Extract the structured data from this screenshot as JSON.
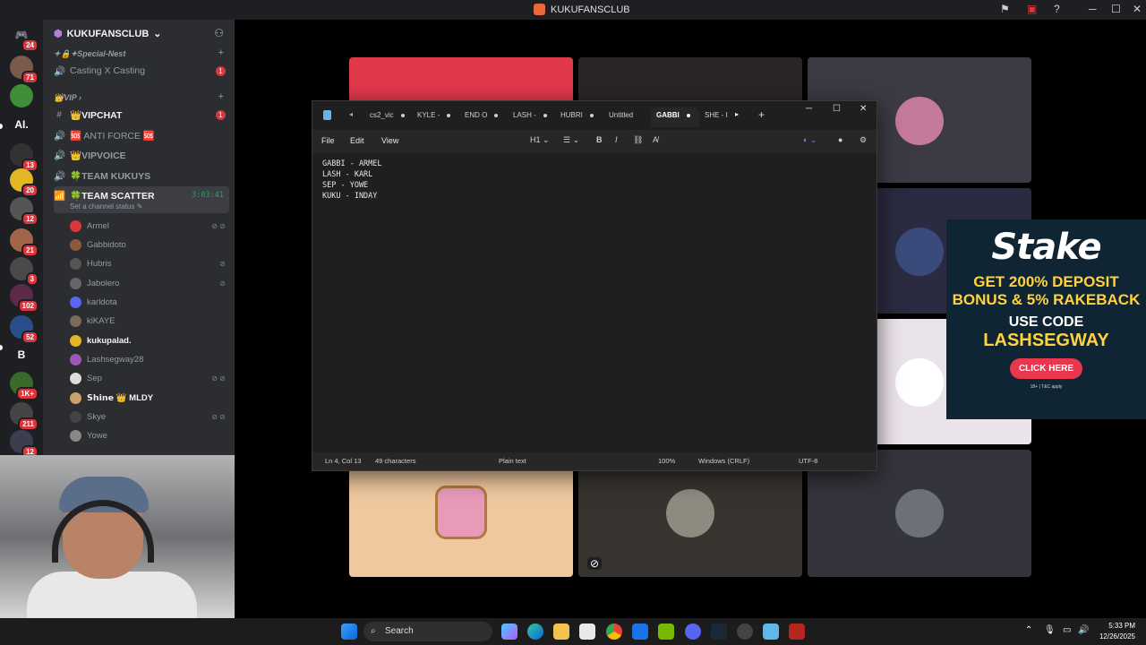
{
  "window": {
    "title": "KUKUFANSCLUB"
  },
  "servers": [
    {
      "label": "",
      "badge": "24"
    },
    {
      "label": "",
      "badge": "71"
    },
    {
      "label": "",
      "badge": ""
    },
    {
      "label": "AI.",
      "badge": ""
    },
    {
      "label": "",
      "badge": "13"
    },
    {
      "label": "",
      "badge": "20"
    },
    {
      "label": "",
      "badge": "12"
    },
    {
      "label": "",
      "badge": "21"
    },
    {
      "label": "",
      "badge": "3"
    },
    {
      "label": "",
      "badge": "102"
    },
    {
      "label": "",
      "badge": "52"
    },
    {
      "label": "B",
      "badge": ""
    },
    {
      "label": "",
      "badge": "1K+"
    },
    {
      "label": "",
      "badge": "211"
    },
    {
      "label": "",
      "badge": "12"
    }
  ],
  "guild": {
    "name": "KUKUFANSCLUB"
  },
  "categories": {
    "special": "✦🔒✦Special-Nest",
    "vip": "👑VIP"
  },
  "channels": [
    {
      "name": "Casting X Casting",
      "mention": "1"
    },
    {
      "name": "👑VIPCHAT",
      "mention": "1"
    },
    {
      "name": "🆘 ANTI FORCE 🆘",
      "mention": ""
    },
    {
      "name": "👑VIPVOICE",
      "mention": ""
    },
    {
      "name": "🍀TEAM KUKUYS",
      "mention": ""
    },
    {
      "name": "🍀TEAM SCATTER",
      "mention": "",
      "timer": "3:03:41",
      "status": "Set a channel status ✎"
    }
  ],
  "voice_users": [
    {
      "name": "Armel",
      "icons": "⊘ ⊘"
    },
    {
      "name": "Gabbidoto",
      "icons": ""
    },
    {
      "name": "Hubris",
      "icons": "⊘"
    },
    {
      "name": "Jabolero",
      "icons": "⊘"
    },
    {
      "name": "karldota",
      "icons": ""
    },
    {
      "name": "kiKAYE",
      "icons": ""
    },
    {
      "name": "kukupalad.",
      "icons": ""
    },
    {
      "name": "Lashsegway28",
      "icons": ""
    },
    {
      "name": "Sep",
      "icons": "⊘ ⊘"
    },
    {
      "name": "𝗦𝗵𝗶𝗻𝗲 👑 MLDY",
      "icons": ""
    },
    {
      "name": "Skye",
      "icons": "⊘ ⊘"
    },
    {
      "name": "Yowe",
      "icons": ""
    }
  ],
  "notepad": {
    "tabs": [
      "cs2_vic",
      "KYLE -",
      "END O",
      "LASH -",
      "HUBRI",
      "Untitled",
      "GABBI",
      "SHE - I"
    ],
    "menu": {
      "file": "File",
      "edit": "Edit",
      "view": "View"
    },
    "heading": "H1",
    "content": "GABBI - ARMEL\nLASH - KARL\nSEP - YOWE\nKUKU - INDAY",
    "status": {
      "position": "Ln 4, Col 13",
      "chars": "49 characters",
      "type": "Plain text",
      "zoom": "100%",
      "eol": "Windows (CRLF)",
      "encoding": "UTF-8"
    }
  },
  "ad": {
    "brand": "Stake",
    "offer": "GET 200% DEPOSIT BONUS & 5% RAKEBACK",
    "use": "USE CODE",
    "code": "LASHSEGWAY",
    "cta": "CLICK HERE",
    "fine": "18+ | T&C apply"
  },
  "taskbar": {
    "search": "Search",
    "time": "5:33 PM",
    "date": "12/26/2025"
  }
}
